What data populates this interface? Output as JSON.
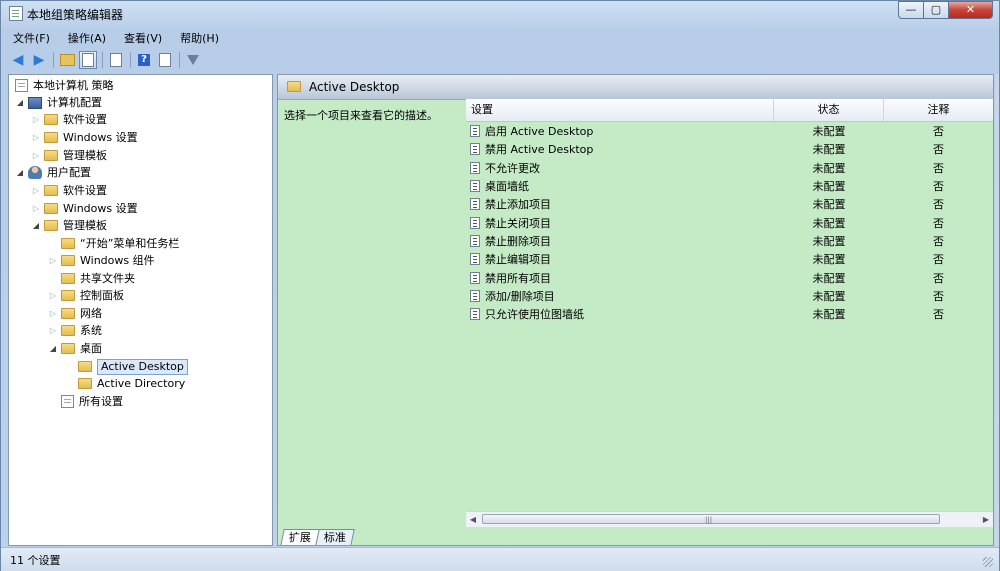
{
  "window": {
    "title": "本地组策略编辑器",
    "controls": {
      "minimize": "—",
      "maximize": "▢",
      "close": "✕"
    }
  },
  "menu": [
    "文件(F)",
    "操作(A)",
    "查看(V)",
    "帮助(H)"
  ],
  "toolbar": [
    "back-icon",
    "forward-icon",
    "up-folder-icon",
    "show-hide-tree-icon",
    "export-list-icon",
    "help-icon",
    "properties-icon",
    "filter-icon"
  ],
  "tree": {
    "root": "本地计算机 策略",
    "computer": "计算机配置",
    "computer_children": [
      "软件设置",
      "Windows 设置",
      "管理模板"
    ],
    "user": "用户配置",
    "user_children": [
      "软件设置",
      "Windows 设置",
      "管理模板"
    ],
    "admin_children": [
      "“开始”菜单和任务栏",
      "Windows 组件",
      "共享文件夹",
      "控制面板",
      "网络",
      "系统",
      "桌面"
    ],
    "desktop_children": [
      "Active Desktop",
      "Active Directory"
    ],
    "all_settings": "所有设置"
  },
  "panel": {
    "title": "Active Desktop",
    "description": "选择一个项目来查看它的描述。",
    "columns": [
      "设置",
      "状态",
      "注释"
    ],
    "rows": [
      {
        "name": "启用 Active Desktop",
        "state": "未配置",
        "note": "否"
      },
      {
        "name": "禁用 Active Desktop",
        "state": "未配置",
        "note": "否"
      },
      {
        "name": "不允许更改",
        "state": "未配置",
        "note": "否"
      },
      {
        "name": "桌面墙纸",
        "state": "未配置",
        "note": "否"
      },
      {
        "name": "禁止添加项目",
        "state": "未配置",
        "note": "否"
      },
      {
        "name": "禁止关闭项目",
        "state": "未配置",
        "note": "否"
      },
      {
        "name": "禁止删除项目",
        "state": "未配置",
        "note": "否"
      },
      {
        "name": "禁止编辑项目",
        "state": "未配置",
        "note": "否"
      },
      {
        "name": "禁用所有项目",
        "state": "未配置",
        "note": "否"
      },
      {
        "name": "添加/删除项目",
        "state": "未配置",
        "note": "否"
      },
      {
        "name": "只允许使用位图墙纸",
        "state": "未配置",
        "note": "否"
      }
    ],
    "tabs": [
      "扩展",
      "标准"
    ],
    "active_tab": "扩展"
  },
  "status": "11 个设置",
  "colors": {
    "panel_bg": "#c4eac6",
    "selection": "#d9e9fb",
    "close_button": "#c7453a"
  }
}
